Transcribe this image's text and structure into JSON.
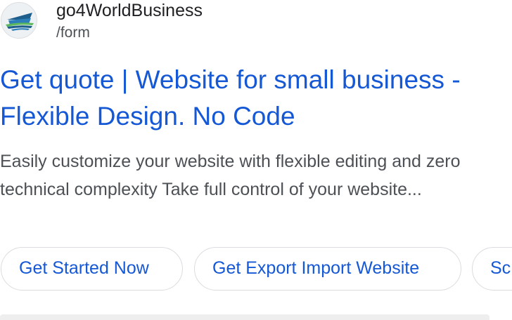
{
  "result": {
    "site": {
      "name": "go4WorldBusiness",
      "path": "/form",
      "favicon_icon": "ship-logo-icon"
    },
    "title": "Get quote | Website for small business - Flexible Design. No Code",
    "snippet": "Easily customize your website with flexible editing and zero technical complexity Take full control of your website...",
    "sitelinks": [
      {
        "label": "Get Started Now"
      },
      {
        "label": "Get Export Import Website"
      },
      {
        "label": "Sc"
      }
    ]
  },
  "colors": {
    "link": "#1558d6",
    "text": "#4d5156",
    "chip_border": "#dadce0"
  }
}
